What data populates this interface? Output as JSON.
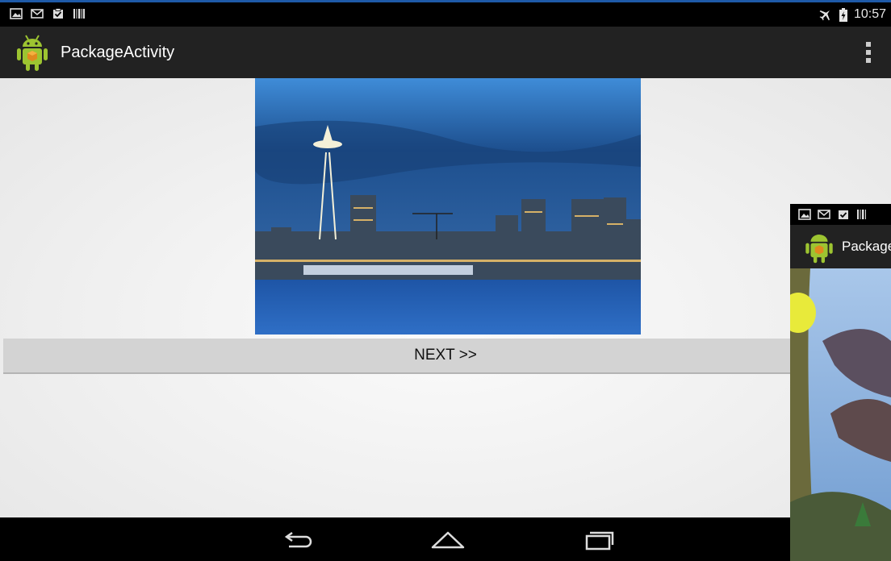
{
  "status_bar": {
    "left_icons": [
      "image-icon",
      "mail-icon",
      "clipboard-check-icon",
      "barcode-icon"
    ],
    "right_icons": [
      "airplane-mode-icon",
      "battery-charging-icon"
    ],
    "time": "10:57"
  },
  "action_bar": {
    "app_icon": "android-icon",
    "title": "PackageActivity",
    "overflow_icon": "overflow-menu-icon"
  },
  "main": {
    "photo": "city-skyline-photo",
    "next_button_label": "NEXT >>"
  },
  "nav_bar": {
    "back_icon": "back-icon",
    "home_icon": "home-icon",
    "recents_icon": "recents-icon"
  },
  "overlay_window": {
    "app_icon": "android-icon",
    "title": "Package",
    "image": "cartoon-scene-photo"
  },
  "colors": {
    "frame_accent": "#1e5aa8",
    "action_bar_bg": "#222222",
    "content_bg": "#f0f0f0",
    "button_bg": "#d3d3d3",
    "android_green": "#9dc431"
  }
}
